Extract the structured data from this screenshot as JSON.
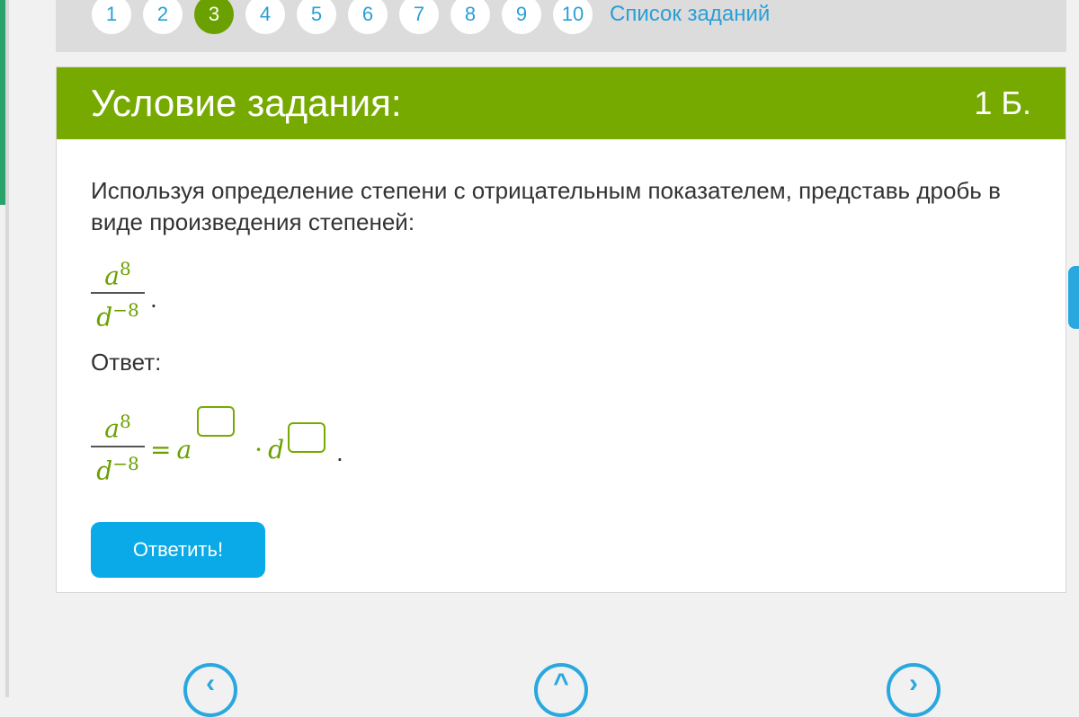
{
  "nav": {
    "numbers": [
      "1",
      "2",
      "3",
      "4",
      "5",
      "6",
      "7",
      "8",
      "9",
      "10"
    ],
    "active_index": 2,
    "list_link": "Список заданий"
  },
  "card": {
    "title": "Условие задания:",
    "points": "1 Б.",
    "task_text": "Используя определение степени с отрицательным показателем, представь дробь в виде произведения степеней:",
    "fraction": {
      "numerator_base": "a",
      "numerator_exp": "8",
      "denominator_base": "d",
      "denominator_exp": "−8"
    },
    "given_period": ".",
    "answer_label": "Ответ:",
    "answer": {
      "equals": "=",
      "base_a": "a",
      "exp_a_value": "",
      "times": "·",
      "base_d": "d",
      "exp_d_value": "",
      "period": "."
    },
    "submit_label": "Ответить!"
  },
  "bottom_nav": {
    "prev_icon": "chevron-left-icon",
    "up_icon": "chevron-up-icon",
    "next_icon": "chevron-right-icon"
  },
  "colors": {
    "header_green": "#77aa00",
    "math_green": "#6aa100",
    "link_blue": "#2a9fd6",
    "button_blue": "#0aaae8"
  }
}
